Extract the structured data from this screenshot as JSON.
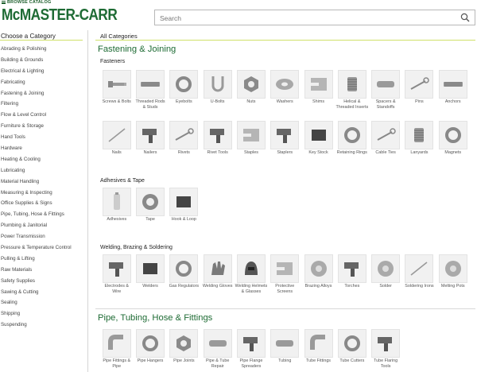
{
  "header": {
    "browse_catalog": "BROWSE CATALOG",
    "logo": "McMASTER-CARR",
    "search_placeholder": "Search"
  },
  "sidebar": {
    "title": "Choose a Category",
    "items": [
      "Abrading & Polishing",
      "Building & Grounds",
      "Electrical & Lighting",
      "Fabricating",
      "Fastening & Joining",
      "Filtering",
      "Flow & Level Control",
      "Furniture & Storage",
      "Hand Tools",
      "Hardware",
      "Heating & Cooling",
      "Lubricating",
      "Material Handling",
      "Measuring & Inspecting",
      "Office Supplies & Signs",
      "Pipe, Tubing, Hose & Fittings",
      "Plumbing & Janitorial",
      "Power Transmission",
      "Pressure & Temperature Control",
      "Pulling & Lifting",
      "Raw Materials",
      "Safety Supplies",
      "Sawing & Cutting",
      "Sealing",
      "Shipping",
      "Suspending"
    ]
  },
  "main": {
    "all_categories": "All Categories",
    "fastening": {
      "title": "Fastening & Joining",
      "fasteners_title": "Fasteners",
      "fasteners_row1": [
        {
          "label": "Screws & Bolts",
          "icon": "screw-icon"
        },
        {
          "label": "Threaded Rods & Studs",
          "icon": "threaded-rod-icon"
        },
        {
          "label": "Eyebolts",
          "icon": "eyebolt-icon"
        },
        {
          "label": "U-Bolts",
          "icon": "u-bolt-icon"
        },
        {
          "label": "Nuts",
          "icon": "nut-icon"
        },
        {
          "label": "Washers",
          "icon": "washer-icon"
        },
        {
          "label": "Shims",
          "icon": "shim-icon"
        },
        {
          "label": "Helical & Threaded Inserts",
          "icon": "helical-insert-icon"
        },
        {
          "label": "Spacers & Standoffs",
          "icon": "spacer-icon"
        },
        {
          "label": "Pins",
          "icon": "pin-icon"
        },
        {
          "label": "Anchors",
          "icon": "anchor-icon"
        }
      ],
      "fasteners_row2": [
        {
          "label": "Nails",
          "icon": "nail-icon"
        },
        {
          "label": "Nailers",
          "icon": "nailer-icon"
        },
        {
          "label": "Rivets",
          "icon": "rivet-icon"
        },
        {
          "label": "Rivet Tools",
          "icon": "rivet-tool-icon"
        },
        {
          "label": "Staples",
          "icon": "staple-icon"
        },
        {
          "label": "Staplers",
          "icon": "stapler-icon"
        },
        {
          "label": "Key Stock",
          "icon": "key-stock-icon"
        },
        {
          "label": "Retaining Rings",
          "icon": "retaining-ring-icon"
        },
        {
          "label": "Cable Ties",
          "icon": "cable-tie-icon"
        },
        {
          "label": "Lanyards",
          "icon": "lanyard-icon"
        },
        {
          "label": "Magnets",
          "icon": "magnet-icon"
        }
      ],
      "adhesives_title": "Adhesives & Tape",
      "adhesives": [
        {
          "label": "Adhesives",
          "icon": "adhesive-icon"
        },
        {
          "label": "Tape",
          "icon": "tape-icon"
        },
        {
          "label": "Hook & Loop",
          "icon": "hook-loop-icon"
        }
      ],
      "welding_title": "Welding, Brazing & Soldering",
      "welding": [
        {
          "label": "Electrodes & Wire",
          "icon": "electrode-icon"
        },
        {
          "label": "Welders",
          "icon": "welder-icon"
        },
        {
          "label": "Gas Regulators",
          "icon": "gas-regulator-icon"
        },
        {
          "label": "Welding Gloves",
          "icon": "glove-icon"
        },
        {
          "label": "Welding Helmets & Glasses",
          "icon": "helmet-icon"
        },
        {
          "label": "Protective Screens",
          "icon": "screen-icon"
        },
        {
          "label": "Brazing Alloys",
          "icon": "brazing-alloy-icon"
        },
        {
          "label": "Torches",
          "icon": "torch-icon"
        },
        {
          "label": "Solder",
          "icon": "solder-icon"
        },
        {
          "label": "Soldering Irons",
          "icon": "soldering-iron-icon"
        },
        {
          "label": "Melting Pots",
          "icon": "melting-pot-icon"
        }
      ]
    },
    "pipe": {
      "title": "Pipe, Tubing, Hose & Fittings",
      "items": [
        {
          "label": "Pipe Fittings & Pipe",
          "icon": "pipe-fitting-icon"
        },
        {
          "label": "Pipe Hangers",
          "icon": "pipe-hanger-icon"
        },
        {
          "label": "Pipe Joints",
          "icon": "pipe-joint-icon"
        },
        {
          "label": "Pipe & Tube Repair",
          "icon": "pipe-repair-icon"
        },
        {
          "label": "Pipe Flange Spreaders",
          "icon": "flange-spreader-icon"
        },
        {
          "label": "Tubing",
          "icon": "tubing-icon"
        },
        {
          "label": "Tube Fittings",
          "icon": "tube-fitting-icon"
        },
        {
          "label": "Tube Cutters",
          "icon": "tube-cutter-icon"
        },
        {
          "label": "Tube Flaring Tools",
          "icon": "flaring-tool-icon"
        }
      ]
    }
  }
}
